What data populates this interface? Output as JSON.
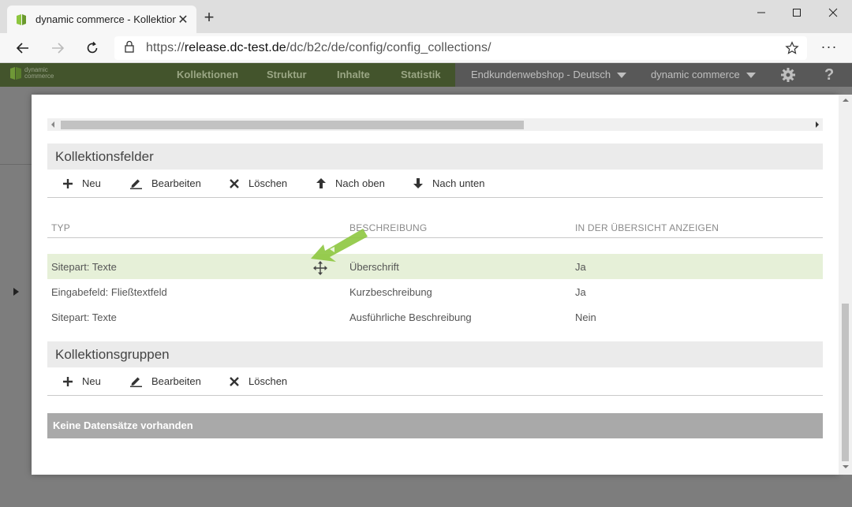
{
  "browser": {
    "tab_title": "dynamic commerce - Kollektione",
    "new_tab": "+",
    "url_prefix": "https://",
    "url_host": "release.dc-test.de",
    "url_path": "/dc/b2c/de/config/config_collections/",
    "more": "···"
  },
  "app": {
    "logo_line1": "dynamic",
    "logo_line2": "commerce",
    "nav": [
      "Kollektionen",
      "Struktur",
      "Inhalte",
      "Statistik"
    ],
    "shop_select": "Endkundenwebshop - Deutsch",
    "user_select": "dynamic commerce",
    "help": "?"
  },
  "fields_section": {
    "title": "Kollektionsfelder",
    "toolbar": {
      "new": "Neu",
      "edit": "Bearbeiten",
      "delete": "Löschen",
      "up": "Nach oben",
      "down": "Nach unten"
    },
    "columns": [
      "TYP",
      "BESCHREIBUNG",
      "IN DER ÜBERSICHT ANZEIGEN"
    ],
    "rows": [
      {
        "type": "Sitepart: Texte",
        "description": "Überschrift",
        "show": "Ja"
      },
      {
        "type": "Eingabefeld: Fließtextfeld",
        "description": "Kurzbeschreibung",
        "show": "Ja"
      },
      {
        "type": "Sitepart: Texte",
        "description": "Ausführliche Beschreibung",
        "show": "Nein"
      }
    ]
  },
  "groups_section": {
    "title": "Kollektionsgruppen",
    "toolbar": {
      "new": "Neu",
      "edit": "Bearbeiten",
      "delete": "Löschen"
    },
    "empty_text": "Keine Datensätze vorhanden"
  },
  "colors": {
    "appbar": "#43542c",
    "highlight_row": "#e6f0d8",
    "accent_green": "#8dc63f"
  }
}
